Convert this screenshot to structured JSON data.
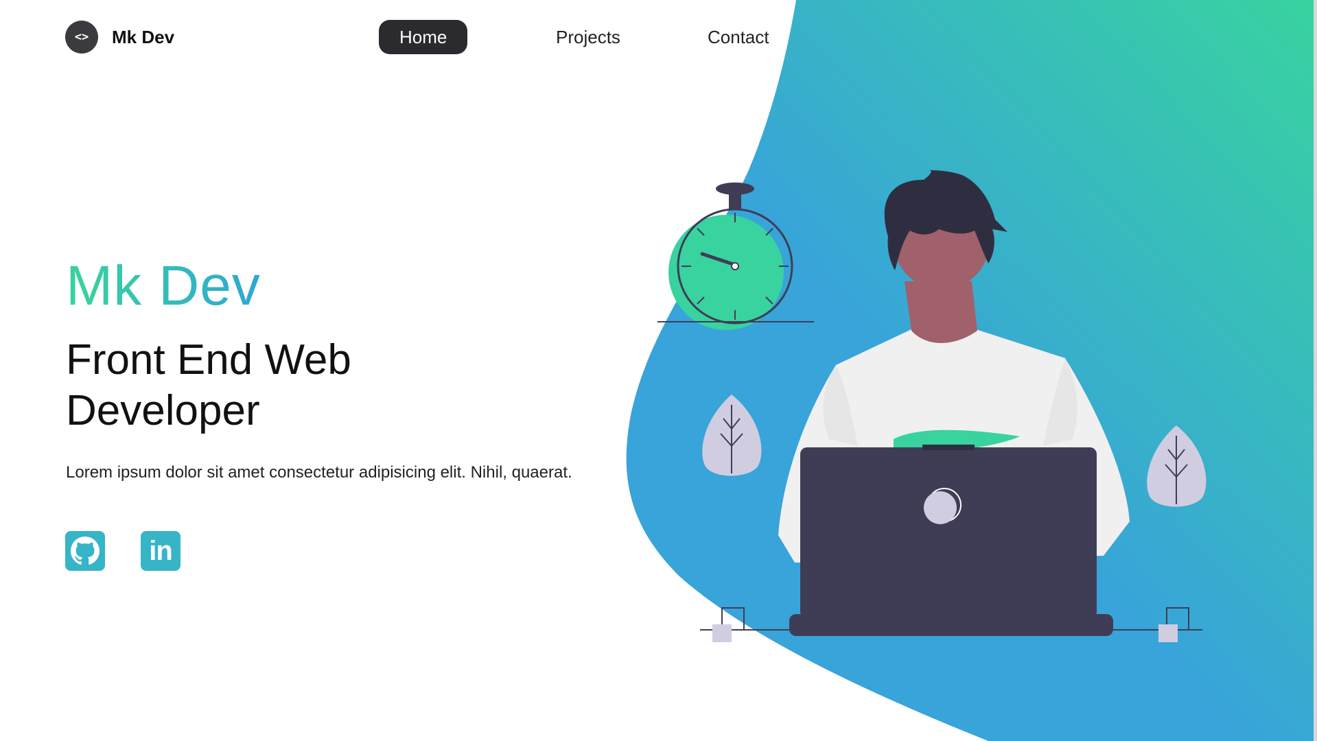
{
  "colors": {
    "gradient_start": "#38d39f",
    "gradient_end": "#38a4d9",
    "nav_active_bg": "#2b2b2f",
    "dark_figure": "#3f3d56",
    "leaf": "#d0cde1",
    "skin": "#a0616a"
  },
  "nav": {
    "logo_symbol": "<>",
    "brand_name": "Mk Dev",
    "links": [
      {
        "label": "Home",
        "active": true
      },
      {
        "label": "Projects",
        "active": false
      },
      {
        "label": "Contact",
        "active": false
      }
    ]
  },
  "hero": {
    "title": "Mk Dev",
    "role_line1": "Front End Web",
    "role_line2": "Developer",
    "description": "Lorem ipsum dolor sit amet consectetur adipisicing elit. Nihil, quaerat."
  },
  "social": {
    "github_icon": "github-icon",
    "linkedin_label": "in"
  }
}
